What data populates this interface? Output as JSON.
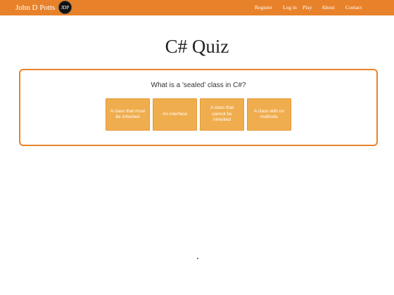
{
  "navbar": {
    "brand": "John D Potts",
    "logo_text": "JDP",
    "links": [
      "Register",
      "Log in",
      "Play",
      "About",
      "Contact"
    ]
  },
  "page": {
    "title": "C# Quiz"
  },
  "quiz": {
    "question": "What is a 'sealed' class in C#?",
    "answers": [
      "A class that must be inherited",
      "An interface",
      "A class that cannot be inherited",
      "A class with no methods"
    ]
  },
  "colors": {
    "brand_orange": "#e8822a",
    "answer_orange": "#f0ad4e"
  }
}
